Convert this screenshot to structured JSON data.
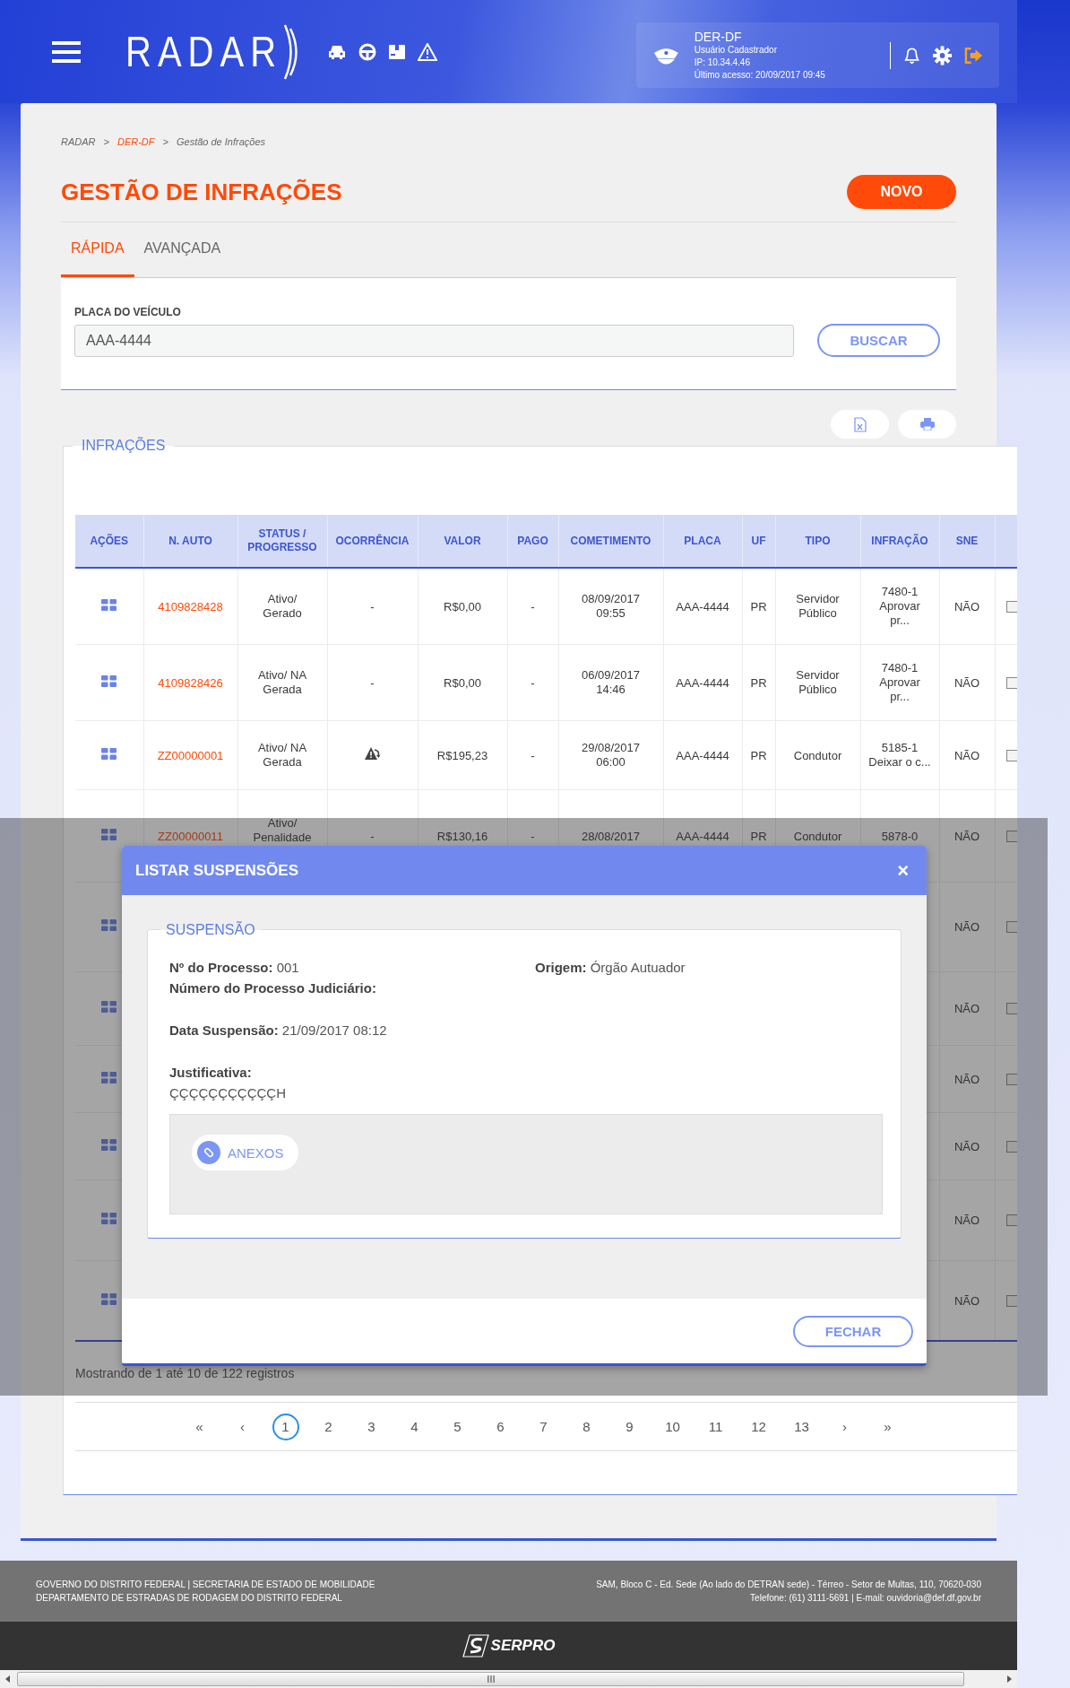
{
  "header": {
    "logo": "RADAR",
    "user": {
      "name": "DER-DF",
      "role": "Usuário Cadastrador",
      "ip": "IP: 10.34.4.46",
      "last_access": "Último acesso: 20/09/2017 09:45"
    }
  },
  "breadcrumb": [
    {
      "kind": "text",
      "label": "RADAR"
    },
    {
      "kind": "separator",
      "label": ">"
    },
    {
      "kind": "link",
      "label": "DER-DF"
    },
    {
      "kind": "separator",
      "label": ">"
    },
    {
      "kind": "text",
      "label": "Gestão de Infrações"
    }
  ],
  "title": "GESTÃO DE INFRAÇÕES",
  "new_button": "NOVO",
  "tabs": [
    {
      "label": "RÁPIDA",
      "selected": true
    },
    {
      "label": "AVANÇADA",
      "selected": false
    }
  ],
  "search": {
    "label": "PLACA DO VEÍCULO",
    "value": "AAA-4444",
    "button": "BUSCAR"
  },
  "infractions": {
    "title": "INFRAÇÕES",
    "columns": [
      "AÇÕES",
      "N. AUTO",
      "STATUS /\nPROGRESSO",
      "OCORRÊNCIA",
      "VALOR",
      "PAGO",
      "COMETIMENTO",
      "PLACA",
      "UF",
      "TIPO",
      "INFRAÇÃO",
      "SNE"
    ],
    "rows": [
      {
        "auto": "4109828428",
        "status": "Ativo/\nGerado",
        "ocorrencia": {
          "kind": "text",
          "text": "-"
        },
        "valor": "R$0,00",
        "pago": "-",
        "cometimento": "08/09/2017\n09:55",
        "placa": "AAA-4444",
        "uf": "PR",
        "tipo": "Servidor\nPúblico",
        "infracao": "7480-1\nAprovar\npr...",
        "sne": "NÃO",
        "checked": false
      },
      {
        "auto": "4109828426",
        "status": "Ativo/ NA\nGerada",
        "ocorrencia": {
          "kind": "text",
          "text": "-"
        },
        "valor": "R$0,00",
        "pago": "-",
        "cometimento": "06/09/2017\n14:46",
        "placa": "AAA-4444",
        "uf": "PR",
        "tipo": "Servidor\nPúblico",
        "infracao": "7480-1\nAprovar\npr...",
        "sne": "NÃO",
        "checked": false
      },
      {
        "auto": "ZZ00000001",
        "status": "Ativo/ NA\nGerada",
        "ocorrencia": {
          "kind": "icon"
        },
        "valor": "R$195,23",
        "pago": "-",
        "cometimento": "29/08/2017\n06:00",
        "placa": "AAA-4444",
        "uf": "PR",
        "tipo": "Condutor",
        "infracao": "5185-1\nDeixar o c...",
        "sne": "NÃO",
        "checked": false
      },
      {
        "auto": "ZZ00000011",
        "status": "Ativo/\nPenalidade",
        "ocorrencia": {
          "kind": "text",
          "text": "-"
        },
        "valor": "R$130,16",
        "pago": "-",
        "cometimento": "28/08/2017",
        "placa": "AAA-4444",
        "uf": "PR",
        "tipo": "Condutor",
        "infracao": "5878-0",
        "sne": "NÃO",
        "checked": false
      },
      {
        "sne": "NÃO",
        "checked": false
      },
      {
        "sne": "NÃO",
        "checked": false
      },
      {
        "sne": "NÃO",
        "checked": false
      },
      {
        "sne": "NÃO",
        "checked": false
      },
      {
        "sne": "NÃO",
        "checked": false
      },
      {
        "sne": "NÃO",
        "checked": false
      }
    ],
    "summary": "Mostrando de 1 até 10 de 122 registros",
    "pagination": [
      {
        "label": "«",
        "selected": false
      },
      {
        "label": "‹",
        "selected": false
      },
      {
        "label": "1",
        "selected": true
      },
      {
        "label": "2",
        "selected": false
      },
      {
        "label": "3",
        "selected": false
      },
      {
        "label": "4",
        "selected": false
      },
      {
        "label": "5",
        "selected": false
      },
      {
        "label": "6",
        "selected": false
      },
      {
        "label": "7",
        "selected": false
      },
      {
        "label": "8",
        "selected": false
      },
      {
        "label": "9",
        "selected": false
      },
      {
        "label": "10",
        "selected": false
      },
      {
        "label": "11",
        "selected": false
      },
      {
        "label": "12",
        "selected": false
      },
      {
        "label": "13",
        "selected": false
      },
      {
        "label": "›",
        "selected": false
      },
      {
        "label": "»",
        "selected": false
      }
    ]
  },
  "modal": {
    "title": "LISTAR SUSPENSÕES",
    "close": "×",
    "section": "SUSPENSÃO",
    "process": {
      "label": "Nº do Processo:",
      "value": "001"
    },
    "origin": {
      "label": "Origem:",
      "value": "Órgão Autuador"
    },
    "judicial": {
      "label": "Número do Processo Judiciário:"
    },
    "date": {
      "label": "Data Suspensão:",
      "value": "21/09/2017 08:12"
    },
    "justification": {
      "label": "Justificativa:",
      "value": "ÇÇÇÇÇÇÇÇÇÇÇH"
    },
    "attachments_button": "ANEXOS",
    "close_button": "FECHAR"
  },
  "footer": {
    "left": [
      "GOVERNO DO DISTRITO FEDERAL | SECRETARIA DE ESTADO DE MOBILIDADE",
      "DEPARTAMENTO DE ESTRADAS DE RODAGEM DO DISTRITO FEDERAL"
    ],
    "right": [
      "SAM, Bloco C - Ed. Sede (Ao lado do DETRAN sede) - Térreo - Setor de Multas, 110, 70620-030",
      "Telefone: (61) 3111-5691 | E-mail: ouvidoria@def.df.gov.br"
    ],
    "brand": "SERPRO"
  }
}
